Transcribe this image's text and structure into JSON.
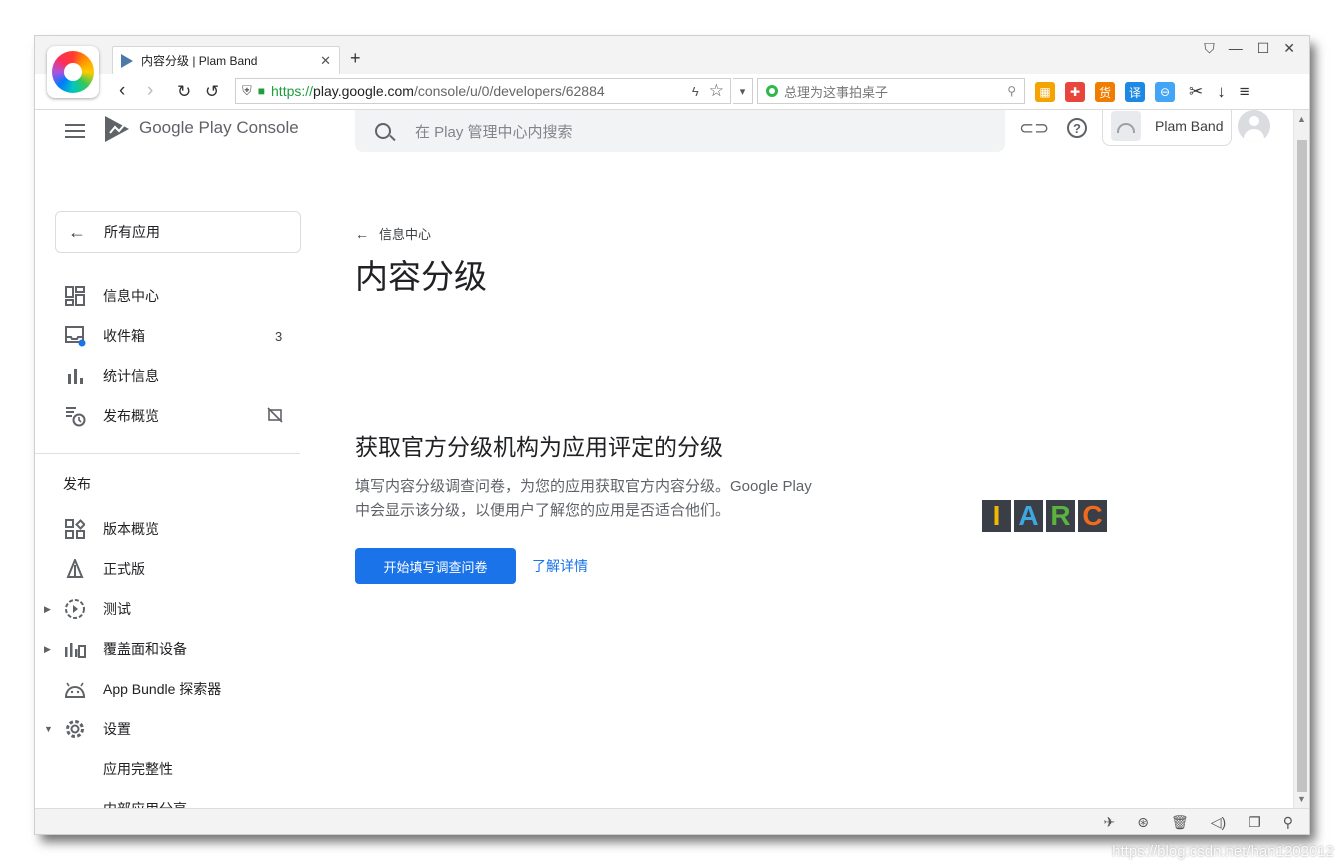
{
  "browser": {
    "tab_title": "内容分级 | Plam Band",
    "url": {
      "scheme": "https://",
      "host": "play.google.com",
      "rest": "/console/u/0/developers/62884"
    },
    "search_placeholder": "总理为这事拍桌子",
    "ext_icons": [
      {
        "name": "apps-ext-icon",
        "glyph": "▦",
        "color": "#f4a300"
      },
      {
        "name": "game-ext-icon",
        "glyph": "✚",
        "color": "#e8453c"
      },
      {
        "name": "coupon-ext-icon",
        "glyph": "货",
        "color": "#f07c00"
      },
      {
        "name": "translate-ext-icon",
        "glyph": "译",
        "color": "#1e88e5"
      },
      {
        "name": "block-ext-icon",
        "glyph": "⊖",
        "color": "#42a5f5"
      }
    ]
  },
  "console": {
    "brand": "Google Play Console",
    "search_placeholder": "在 Play 管理中心内搜索",
    "developer_name": "Plam Band"
  },
  "sidebar": {
    "all_apps_label": "所有应用",
    "items": [
      {
        "name": "sidebar-item-dashboard",
        "icon": "dashboard-icon",
        "label": "信息中心",
        "badge": ""
      },
      {
        "name": "sidebar-item-inbox",
        "icon": "inbox-icon",
        "label": "收件箱",
        "badge": "3"
      },
      {
        "name": "sidebar-item-statistics",
        "icon": "bar-chart-icon",
        "label": "统计信息",
        "badge": ""
      },
      {
        "name": "sidebar-item-publishing-overview",
        "icon": "publish-schedule-icon",
        "label": "发布概览",
        "badge": ""
      }
    ],
    "release_section_label": "发布",
    "release_items": [
      {
        "name": "sidebar-item-release-overview",
        "icon": "release-overview-icon",
        "label": "版本概览"
      },
      {
        "name": "sidebar-item-production",
        "icon": "production-icon",
        "label": "正式版"
      },
      {
        "name": "sidebar-item-testing",
        "icon": "testing-icon",
        "label": "测试"
      },
      {
        "name": "sidebar-item-reach-devices",
        "icon": "reach-devices-icon",
        "label": "覆盖面和设备"
      },
      {
        "name": "sidebar-item-app-bundle-explorer",
        "icon": "android-icon",
        "label": "App Bundle 探索器"
      },
      {
        "name": "sidebar-item-settings",
        "icon": "gear-icon",
        "label": "设置"
      }
    ],
    "sub_items": [
      {
        "name": "sidebar-subitem-app-integrity",
        "label": "应用完整性"
      },
      {
        "name": "sidebar-subitem-internal-sharing",
        "label": "内部应用分享"
      }
    ]
  },
  "main": {
    "breadcrumb": "信息中心",
    "title": "内容分级",
    "section_title": "获取官方分级机构为应用评定的分级",
    "section_desc": "填写内容分级调查问卷，为您的应用获取官方内容分级。Google Play 中会显示该分级，以便用户了解您的应用是否适合他们。",
    "start_button": "开始填写调查问卷",
    "learn_more": "了解详情",
    "iarc_letters": [
      {
        "char": "I",
        "color": "#f2b705"
      },
      {
        "char": "A",
        "color": "#3fa6e0"
      },
      {
        "char": "R",
        "color": "#5bb33f"
      },
      {
        "char": "C",
        "color": "#f26b1d"
      }
    ]
  },
  "watermark": "https://blog.csdn.net/han1202012"
}
